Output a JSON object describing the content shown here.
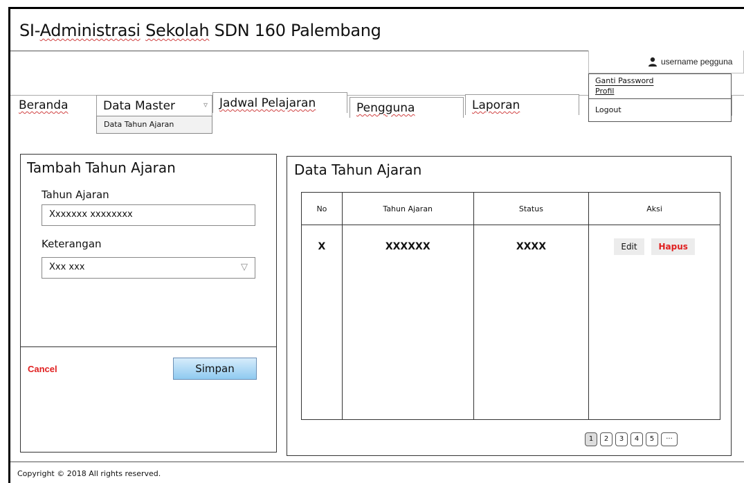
{
  "app": {
    "title_prefix": "SI-",
    "title_word1": "Administrasi",
    "title_space": " ",
    "title_word2": "Sekolah",
    "title_suffix": " SDN 160 Palembang"
  },
  "user": {
    "name": "username pegguna",
    "menu": [
      "Ganti Password",
      "Profil",
      "Logout"
    ]
  },
  "nav": {
    "items": [
      "Beranda",
      "Data Master",
      "Jadwal Pelajaran",
      "Pengguna",
      "Laporan"
    ],
    "dropdown_glyph": "▿",
    "submenu": [
      "Data Tahun Ajaran"
    ]
  },
  "form": {
    "title": "Tambah Tahun Ajaran",
    "tahun_label": "Tahun Ajaran",
    "tahun_value": "Xxxxxxx xxxxxxxx",
    "keterangan_label": "Keterangan",
    "keterangan_value": "Xxx xxx",
    "select_glyph": "▽",
    "cancel": "Cancel",
    "save": "Simpan"
  },
  "list": {
    "title": "Data Tahun Ajaran",
    "columns": [
      "No",
      "Tahun Ajaran",
      "Status",
      "Aksi"
    ],
    "rows": [
      {
        "no": "X",
        "tahun": "XXXXXX",
        "status": "XXXX"
      }
    ],
    "edit": "Edit",
    "delete": "Hapus"
  },
  "pagination": [
    "1",
    "2",
    "3",
    "4",
    "5",
    "···"
  ],
  "footer": {
    "copyright": "Copyright © 2018  All rights reserved."
  },
  "colors": {
    "danger": "#e02020",
    "primary_button": "#8fcaf0"
  }
}
